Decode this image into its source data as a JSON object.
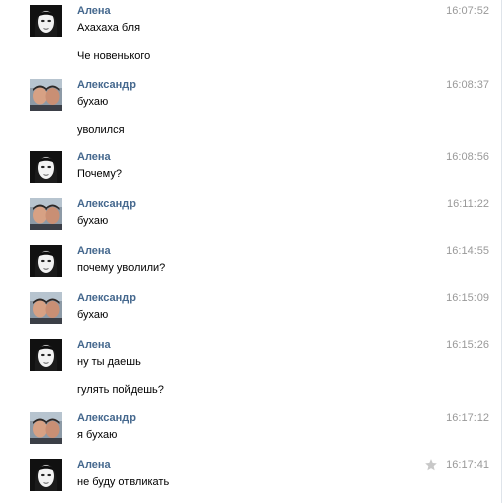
{
  "messages": [
    {
      "author": "Алена",
      "avatar": "alena",
      "time": "16:07:52",
      "starred": false,
      "lines": [
        "Ахахаха бля",
        "Че новенького"
      ]
    },
    {
      "author": "Александр",
      "avatar": "alexander",
      "time": "16:08:37",
      "starred": false,
      "lines": [
        "бухаю",
        "уволился"
      ]
    },
    {
      "author": "Алена",
      "avatar": "alena",
      "time": "16:08:56",
      "starred": false,
      "lines": [
        "Почему?"
      ]
    },
    {
      "author": "Александр",
      "avatar": "alexander",
      "time": "16:11:22",
      "starred": false,
      "lines": [
        "бухаю"
      ]
    },
    {
      "author": "Алена",
      "avatar": "alena",
      "time": "16:14:55",
      "starred": false,
      "lines": [
        "почему уволили?"
      ]
    },
    {
      "author": "Александр",
      "avatar": "alexander",
      "time": "16:15:09",
      "starred": false,
      "lines": [
        "бухаю"
      ]
    },
    {
      "author": "Алена",
      "avatar": "alena",
      "time": "16:15:26",
      "starred": false,
      "lines": [
        "ну ты даешь",
        "гулять пойдешь?"
      ]
    },
    {
      "author": "Александр",
      "avatar": "alexander",
      "time": "16:17:12",
      "starred": false,
      "lines": [
        "я бухаю"
      ]
    },
    {
      "author": "Алена",
      "avatar": "alena",
      "time": "16:17:41",
      "starred": true,
      "lines": [
        "не буду отвликать"
      ]
    }
  ],
  "colors": {
    "author": "#45688e",
    "time": "#999999",
    "star": "#c8c8c8"
  }
}
